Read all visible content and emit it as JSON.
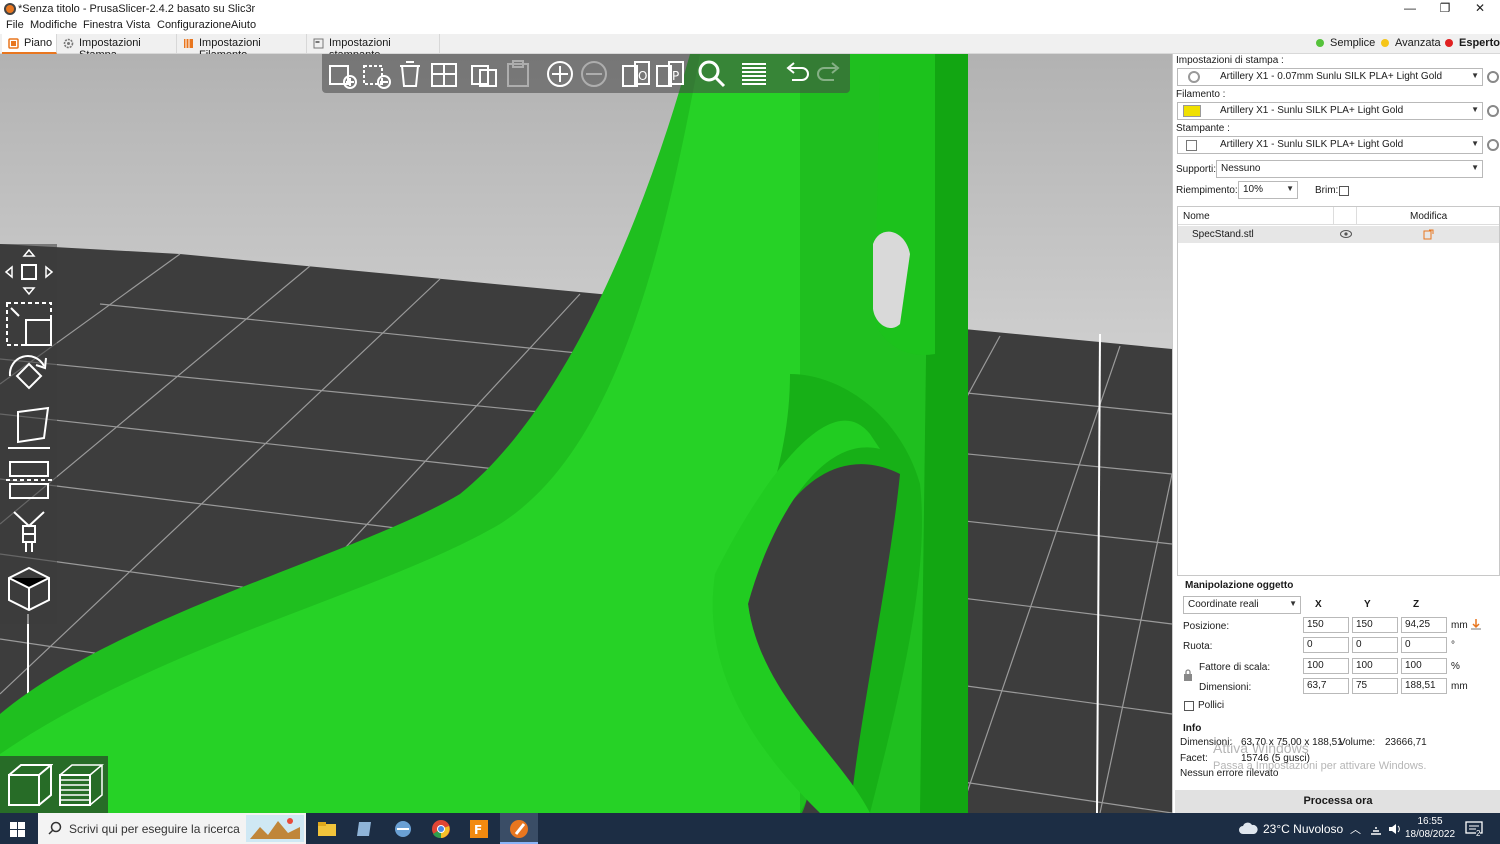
{
  "window": {
    "title": "*Senza titolo - PrusaSlicer-2.4.2 basato su Slic3r",
    "minimize": "—",
    "maximize": "❐",
    "close": "✕"
  },
  "menu": [
    "File",
    "Modifiche",
    "Finestra",
    "Vista",
    "Configurazione",
    "Aiuto"
  ],
  "tabs": [
    "Piano",
    "Impostazioni Stampa",
    "Impostazioni Filamento",
    "Impostazioni stampante"
  ],
  "modes": [
    {
      "label": "Semplice",
      "color": "#55c23a"
    },
    {
      "label": "Avanzata",
      "color": "#f5c518"
    },
    {
      "label": "Esperto",
      "color": "#e02020"
    }
  ],
  "colors": {
    "accent": "#e8761f",
    "model": "#22c722",
    "bed": "#3c3c3c",
    "filament_swatch": "#f0e000"
  },
  "presets": {
    "print_label": "Impostazioni di stampa :",
    "print_value": "Artillery X1 - 0.07mm Sunlu SILK PLA+ Light Gold",
    "filament_label": "Filamento :",
    "filament_value": "Artillery X1 - Sunlu SILK PLA+ Light Gold",
    "printer_label": "Stampante :",
    "printer_value": "Artillery X1 - Sunlu SILK PLA+ Light Gold",
    "supports_label": "Supporti:",
    "supports_value": "Nessuno",
    "infill_label": "Riempimento:",
    "infill_value": "10%",
    "brim_label": "Brim:"
  },
  "object_list": {
    "col_name": "Nome",
    "col_edit": "Modifica",
    "items": [
      {
        "name": "SpecStand.stl"
      }
    ]
  },
  "manipulation": {
    "title": "Manipolazione oggetto",
    "coord_mode": "Coordinate reali",
    "axes": [
      "X",
      "Y",
      "Z"
    ],
    "rows": [
      {
        "label": "Posizione:",
        "values": [
          "150",
          "150",
          "94,25"
        ],
        "unit": "mm"
      },
      {
        "label": "Ruota:",
        "values": [
          "0",
          "0",
          "0"
        ],
        "unit": "°"
      },
      {
        "label": "Fattore di scala:",
        "values": [
          "100",
          "100",
          "100"
        ],
        "unit": "%"
      },
      {
        "label": "Dimensioni:",
        "values": [
          "63,7",
          "75",
          "188,51"
        ],
        "unit": "mm"
      }
    ],
    "inches_label": "Pollici"
  },
  "info": {
    "title": "Info",
    "size_label": "Dimensioni:",
    "size_value": "63,70 x 75,00 x 188,51",
    "volume_label": "Volume:",
    "volume_value": "23666,71",
    "facets_label": "Facet:",
    "facets_value": "15746 (5 gusci)",
    "errors": "Nessun errore rilevato"
  },
  "watermark": {
    "line1": "Attiva Windows",
    "line2": "Passa a Impostazioni per attivare Windows."
  },
  "slice_button": "Processa ora",
  "taskbar": {
    "search_placeholder": "Scrivi qui per eseguire la ricerca",
    "weather": "23°C  Nuvoloso",
    "time": "16:55",
    "date": "18/08/2022",
    "notification_count": "2"
  }
}
